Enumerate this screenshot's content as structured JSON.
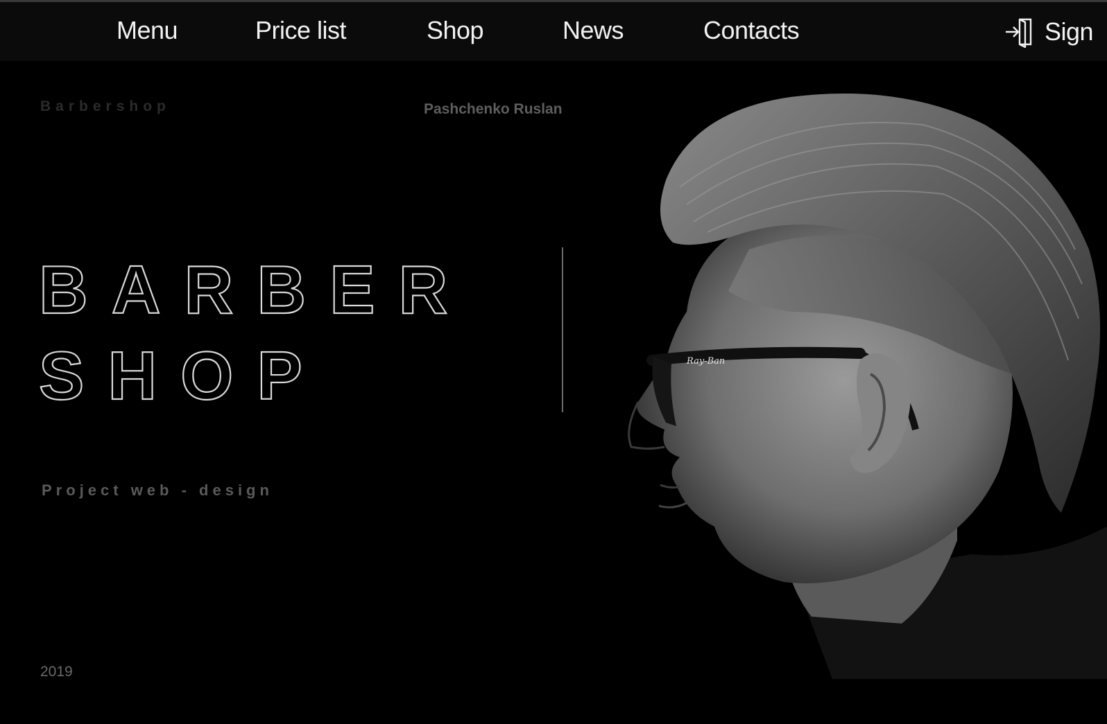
{
  "nav": {
    "items": [
      {
        "label": "Menu"
      },
      {
        "label": "Price list"
      },
      {
        "label": "Shop"
      },
      {
        "label": "News"
      },
      {
        "label": "Contacts"
      }
    ],
    "sign_label": "Sign",
    "sign_icon": "sign-in-icon"
  },
  "hero": {
    "brand_small": "Barbershop",
    "author": "Pashchenko Ruslan",
    "headline_line1": "BARBER",
    "headline_line2": "SHOP",
    "project": "Project web - design",
    "year": "2019",
    "glasses_brand": "Ray-Ban"
  },
  "colors": {
    "background": "#000000",
    "topbar": "#0b0b0b",
    "nav_text": "#f2f2f2",
    "headline_stroke": "#d9d9d9",
    "muted_text": "#5e5e5e"
  }
}
